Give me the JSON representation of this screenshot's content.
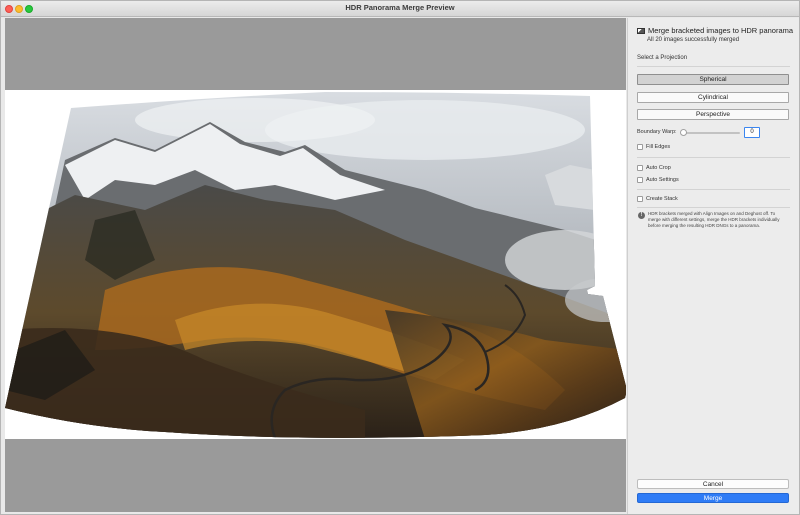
{
  "window": {
    "title": "HDR Panorama Merge Preview"
  },
  "panel": {
    "heading": "Merge bracketed images to HDR panorama",
    "subheading": "All 20 images successfully merged",
    "select_projection_label": "Select a Projection",
    "projections": [
      "Spherical",
      "Cylindrical",
      "Perspective"
    ],
    "selected_projection": "Spherical",
    "boundary_warp_label": "Boundary Warp:",
    "boundary_warp_value": "0",
    "fill_edges_label": "Fill Edges",
    "auto_crop_label": "Auto Crop",
    "auto_settings_label": "Auto Settings",
    "create_stack_label": "Create Stack",
    "info_text": "HDR brackets merged with Align Images on and Deghost off. To merge with different settings, merge the HDR brackets individually before merging the resulting HDR DNGs to a panorama.",
    "cancel_label": "Cancel",
    "merge_label": "Merge"
  },
  "colors": {
    "accent": "#2f7cf6",
    "preview_bg": "#9a9a9a"
  }
}
